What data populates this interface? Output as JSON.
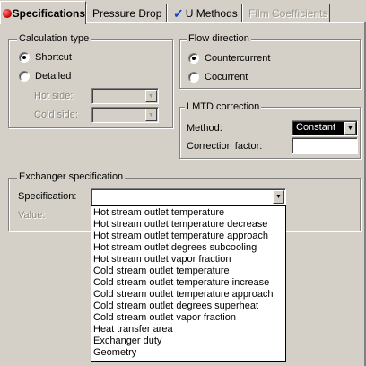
{
  "tabs": [
    {
      "label": "Specifications",
      "state": "active"
    },
    {
      "label": "Pressure Drop",
      "state": "normal"
    },
    {
      "label": "U Methods",
      "state": "normal",
      "icon": "check-icon"
    },
    {
      "label": "Film Coefficients",
      "state": "disabled"
    }
  ],
  "calculation_type": {
    "title": "Calculation type",
    "options": [
      "Shortcut",
      "Detailed"
    ],
    "selected": "Shortcut",
    "hot_side_label": "Hot side:",
    "cold_side_label": "Cold side:",
    "hot_side_value": "",
    "cold_side_value": ""
  },
  "flow_direction": {
    "title": "Flow direction",
    "options": [
      "Countercurrent",
      "Cocurrent"
    ],
    "selected": "Countercurrent"
  },
  "lmtd": {
    "title": "LMTD correction",
    "method_label": "Method:",
    "method_value": "Constant",
    "factor_label": "Correction factor:",
    "factor_value": ""
  },
  "exchanger_spec": {
    "title": "Exchanger specification",
    "spec_label": "Specification:",
    "spec_value": "",
    "value_label": "Value:",
    "options": [
      "Hot stream outlet temperature",
      "Hot stream outlet temperature decrease",
      "Hot stream outlet temperature approach",
      "Hot stream outlet degrees subcooling",
      "Hot stream outlet vapor fraction",
      "Cold stream outlet temperature",
      "Cold stream outlet temperature increase",
      "Cold stream outlet temperature approach",
      "Cold stream outlet degrees superheat",
      "Cold stream outlet vapor fraction",
      "Heat transfer area",
      "Exchanger duty",
      "Geometry"
    ]
  },
  "icons": {
    "status": "red-status-icon",
    "combo_arrow": "chevron-down-icon"
  }
}
